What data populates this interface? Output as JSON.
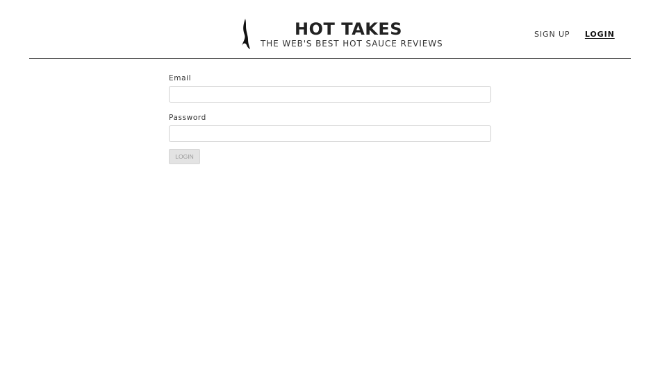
{
  "brand": {
    "title": "HOT TAKES",
    "tagline": "THE WEB'S BEST HOT SAUCE REVIEWS",
    "logo_icon": "flame-icon"
  },
  "nav": {
    "signup_label": "SIGN UP",
    "login_label": "LOGIN",
    "active": "login"
  },
  "form": {
    "email_label": "Email",
    "email_value": "",
    "password_label": "Password",
    "password_value": "",
    "submit_label": "LOGIN",
    "submit_disabled": true
  },
  "colors": {
    "text": "#222222",
    "divider": "#555555",
    "input_border": "#cfcfcf",
    "button_bg": "#e3e3e3",
    "button_text": "#9a9a9a"
  }
}
